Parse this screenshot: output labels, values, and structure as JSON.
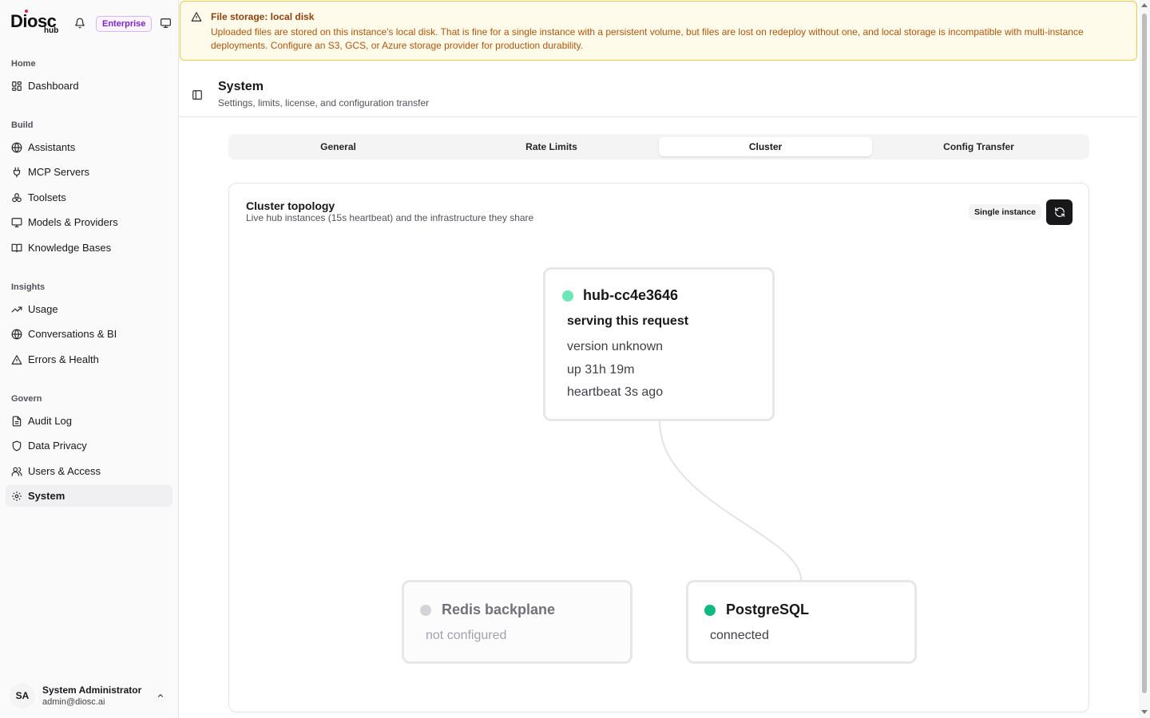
{
  "brand": {
    "logo_text": "Diosc",
    "logo_sub": "hub",
    "plan_badge": "Enterprise"
  },
  "sidebar": {
    "groups": [
      {
        "label": "Home",
        "items": [
          {
            "label": "Dashboard",
            "icon": "dashboard-icon"
          }
        ]
      },
      {
        "label": "Build",
        "items": [
          {
            "label": "Assistants",
            "icon": "globe-icon"
          },
          {
            "label": "MCP Servers",
            "icon": "plug-icon"
          },
          {
            "label": "Toolsets",
            "icon": "boxes-icon"
          },
          {
            "label": "Models & Providers",
            "icon": "monitor-icon"
          },
          {
            "label": "Knowledge Bases",
            "icon": "book-icon"
          }
        ]
      },
      {
        "label": "Insights",
        "items": [
          {
            "label": "Usage",
            "icon": "trending-up-icon"
          },
          {
            "label": "Conversations & BI",
            "icon": "chat-globe-icon"
          },
          {
            "label": "Errors & Health",
            "icon": "warning-icon"
          }
        ]
      },
      {
        "label": "Govern",
        "items": [
          {
            "label": "Audit Log",
            "icon": "document-icon"
          },
          {
            "label": "Data Privacy",
            "icon": "shield-icon"
          },
          {
            "label": "Users & Access",
            "icon": "users-icon"
          },
          {
            "label": "System",
            "icon": "gear-icon",
            "active": true
          }
        ]
      }
    ]
  },
  "user": {
    "initials": "SA",
    "name": "System Administrator",
    "email": "admin@diosc.ai"
  },
  "alert": {
    "title": "File storage: local disk",
    "body": "Uploaded files are stored on this instance's local disk. That is fine for a single instance with a persistent volume, but files are lost on redeploy without one, and local storage is incompatible with multi-instance deployments. Configure an S3, GCS, or Azure storage provider for production durability."
  },
  "page": {
    "title": "System",
    "subtitle": "Settings, limits, license, and configuration transfer"
  },
  "tabs": [
    {
      "label": "General"
    },
    {
      "label": "Rate Limits"
    },
    {
      "label": "Cluster",
      "active": true
    },
    {
      "label": "Config Transfer"
    }
  ],
  "cluster": {
    "title": "Cluster topology",
    "subtitle": "Live hub instances (15s heartbeat) and the infrastructure they share",
    "mode_badge": "Single instance",
    "hub": {
      "name": "hub-cc4e3646",
      "role": "serving this request",
      "version": "version unknown",
      "uptime": "up 31h 19m",
      "heartbeat": "heartbeat 3s ago",
      "status_color": "#6ee7b7"
    },
    "redis": {
      "name": "Redis backplane",
      "status": "not configured",
      "status_color": "#d4d4d8"
    },
    "postgres": {
      "name": "PostgreSQL",
      "status": "connected",
      "status_color": "#10b981"
    }
  }
}
